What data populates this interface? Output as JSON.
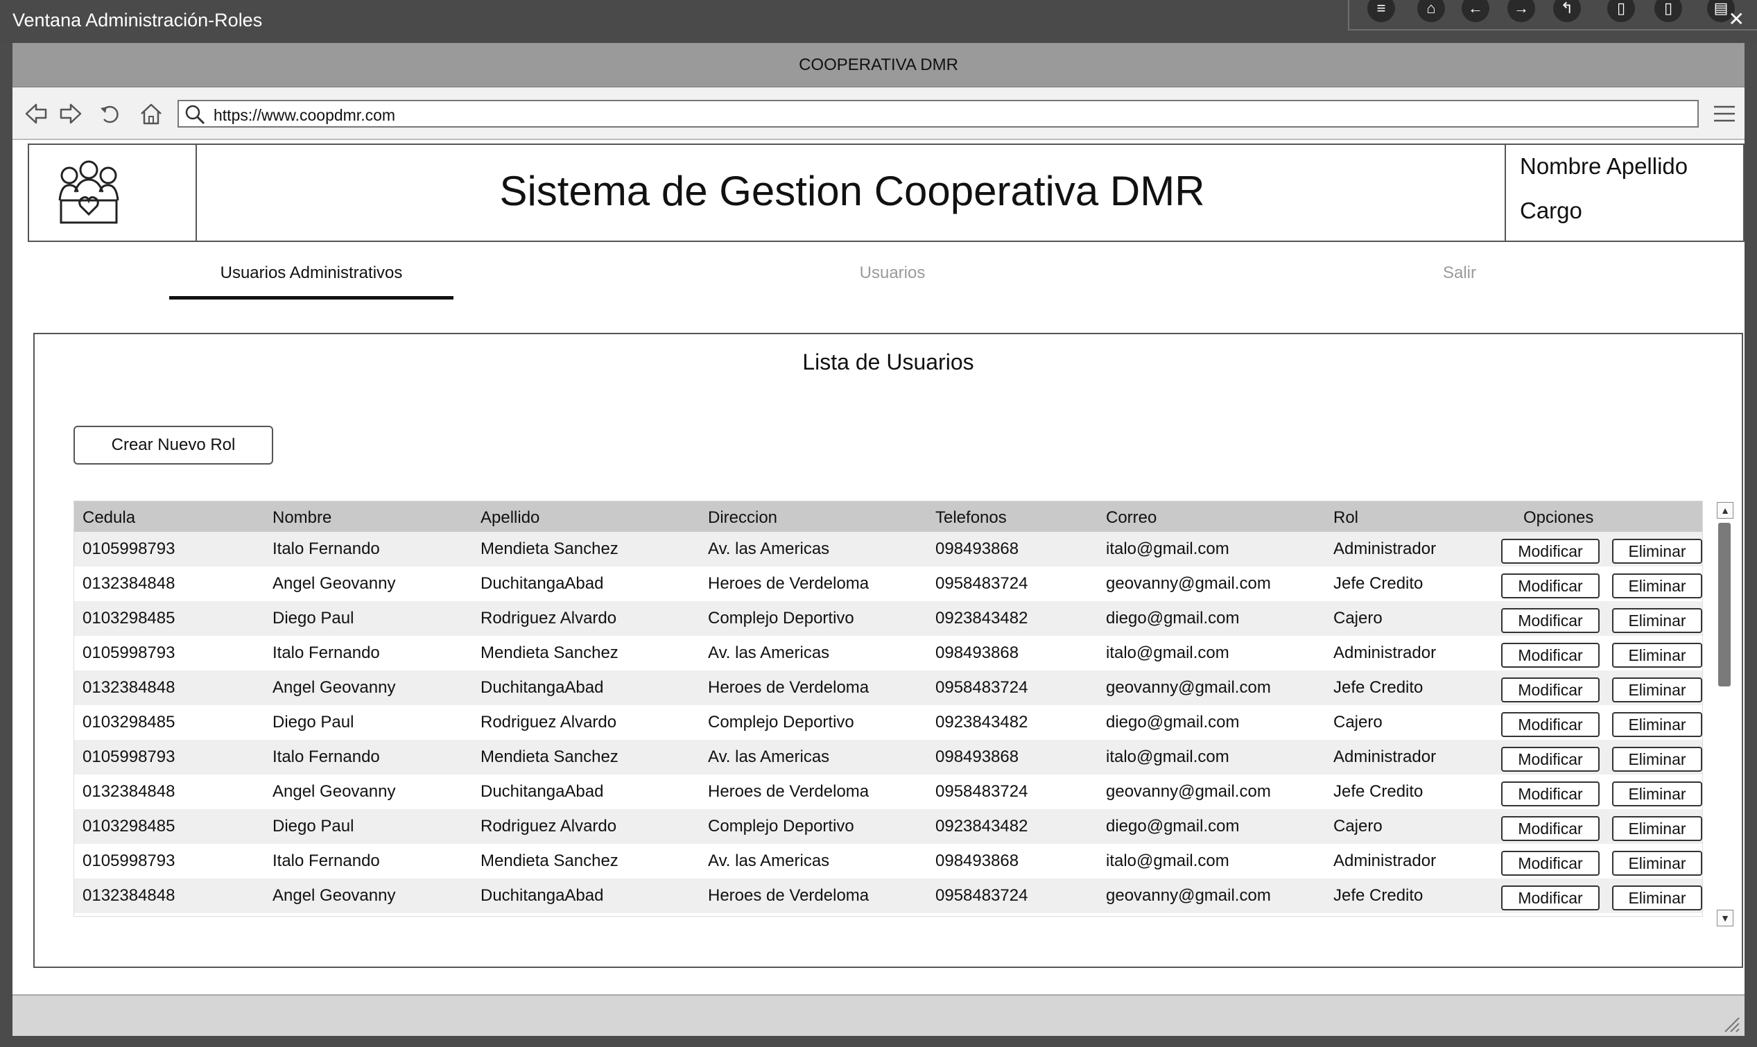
{
  "window": {
    "title": "Ventana Administración-Roles",
    "tool_icons": [
      "menu-icon",
      "home-icon",
      "arrow-left-icon",
      "arrow-right-icon",
      "undo-arrow-icon",
      "document-icon",
      "document-icon",
      "clipboard-icon"
    ],
    "close_glyph": "✕"
  },
  "app": {
    "title": "COOPERATIVA DMR"
  },
  "browser": {
    "url": "https://www.coopdmr.com"
  },
  "header": {
    "title": "Sistema de Gestion Cooperativa DMR",
    "user_name": "Nombre Apellido",
    "user_role": "Cargo"
  },
  "tabs": [
    {
      "label": "Usuarios Administrativos",
      "active": true
    },
    {
      "label": "Usuarios",
      "active": false
    },
    {
      "label": "Salir",
      "active": false
    }
  ],
  "panel": {
    "title": "Lista de Usuarios",
    "new_button": "Crear Nuevo Rol"
  },
  "table": {
    "columns": [
      "Cedula",
      "Nombre",
      "Apellido",
      "Direccion",
      "Telefonos",
      "Correo",
      "Rol",
      "Opciones"
    ],
    "modify_label": "Modificar",
    "delete_label": "Eliminar",
    "rows": [
      [
        "0105998793",
        "Italo Fernando",
        "Mendieta Sanchez",
        "Av. las Americas",
        "098493868",
        "italo@gmail.com",
        "Administrador"
      ],
      [
        "0132384848",
        "Angel Geovanny",
        "DuchitangaAbad",
        "Heroes de Verdeloma",
        "0958483724",
        "geovanny@gmail.com",
        "Jefe Credito"
      ],
      [
        "0103298485",
        "Diego Paul",
        "Rodriguez Alvardo",
        "Complejo Deportivo",
        "0923843482",
        "diego@gmail.com",
        "Cajero"
      ],
      [
        "0105998793",
        "Italo Fernando",
        "Mendieta Sanchez",
        "Av. las Americas",
        "098493868",
        "italo@gmail.com",
        "Administrador"
      ],
      [
        "0132384848",
        "Angel Geovanny",
        "DuchitangaAbad",
        "Heroes de Verdeloma",
        "0958483724",
        "geovanny@gmail.com",
        "Jefe Credito"
      ],
      [
        "0103298485",
        "Diego Paul",
        "Rodriguez Alvardo",
        "Complejo Deportivo",
        "0923843482",
        "diego@gmail.com",
        "Cajero"
      ],
      [
        "0105998793",
        "Italo Fernando",
        "Mendieta Sanchez",
        "Av. las Americas",
        "098493868",
        "italo@gmail.com",
        "Administrador"
      ],
      [
        "0132384848",
        "Angel Geovanny",
        "DuchitangaAbad",
        "Heroes de Verdeloma",
        "0958483724",
        "geovanny@gmail.com",
        "Jefe Credito"
      ],
      [
        "0103298485",
        "Diego Paul",
        "Rodriguez Alvardo",
        "Complejo Deportivo",
        "0923843482",
        "diego@gmail.com",
        "Cajero"
      ],
      [
        "0105998793",
        "Italo Fernando",
        "Mendieta Sanchez",
        "Av. las Americas",
        "098493868",
        "italo@gmail.com",
        "Administrador"
      ],
      [
        "0132384848",
        "Angel Geovanny",
        "DuchitangaAbad",
        "Heroes de Verdeloma",
        "0958483724",
        "geovanny@gmail.com",
        "Jefe Credito"
      ]
    ]
  }
}
